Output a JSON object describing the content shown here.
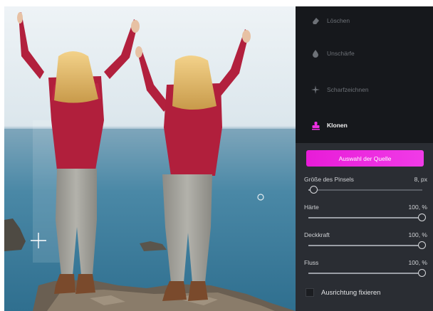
{
  "tools": [
    {
      "label": "Löschen",
      "icon": "eraser-icon",
      "active": false
    },
    {
      "label": "Unschärfe",
      "icon": "drop-icon",
      "active": false
    },
    {
      "label": "Scharfzeichnen",
      "icon": "sparkle-icon",
      "active": false
    },
    {
      "label": "Klonen",
      "icon": "stamp-icon",
      "active": true
    }
  ],
  "source_button": "Auswahl der Quelle",
  "params": [
    {
      "label": "Größe des Pinsels",
      "value": "8, px",
      "level": 0.05
    },
    {
      "label": "Härte",
      "value": "100, %",
      "level": 1.0
    },
    {
      "label": "Deckkraft",
      "value": "100, %",
      "level": 1.0
    },
    {
      "label": "Fluss",
      "value": "100, %",
      "level": 1.0
    }
  ],
  "checkbox": {
    "label": "Ausrichtung fixieren",
    "checked": false
  },
  "colors": {
    "accent": "#ee2ee2",
    "panel_bg": "#2a2d33",
    "tool_bg": "#16181c"
  }
}
